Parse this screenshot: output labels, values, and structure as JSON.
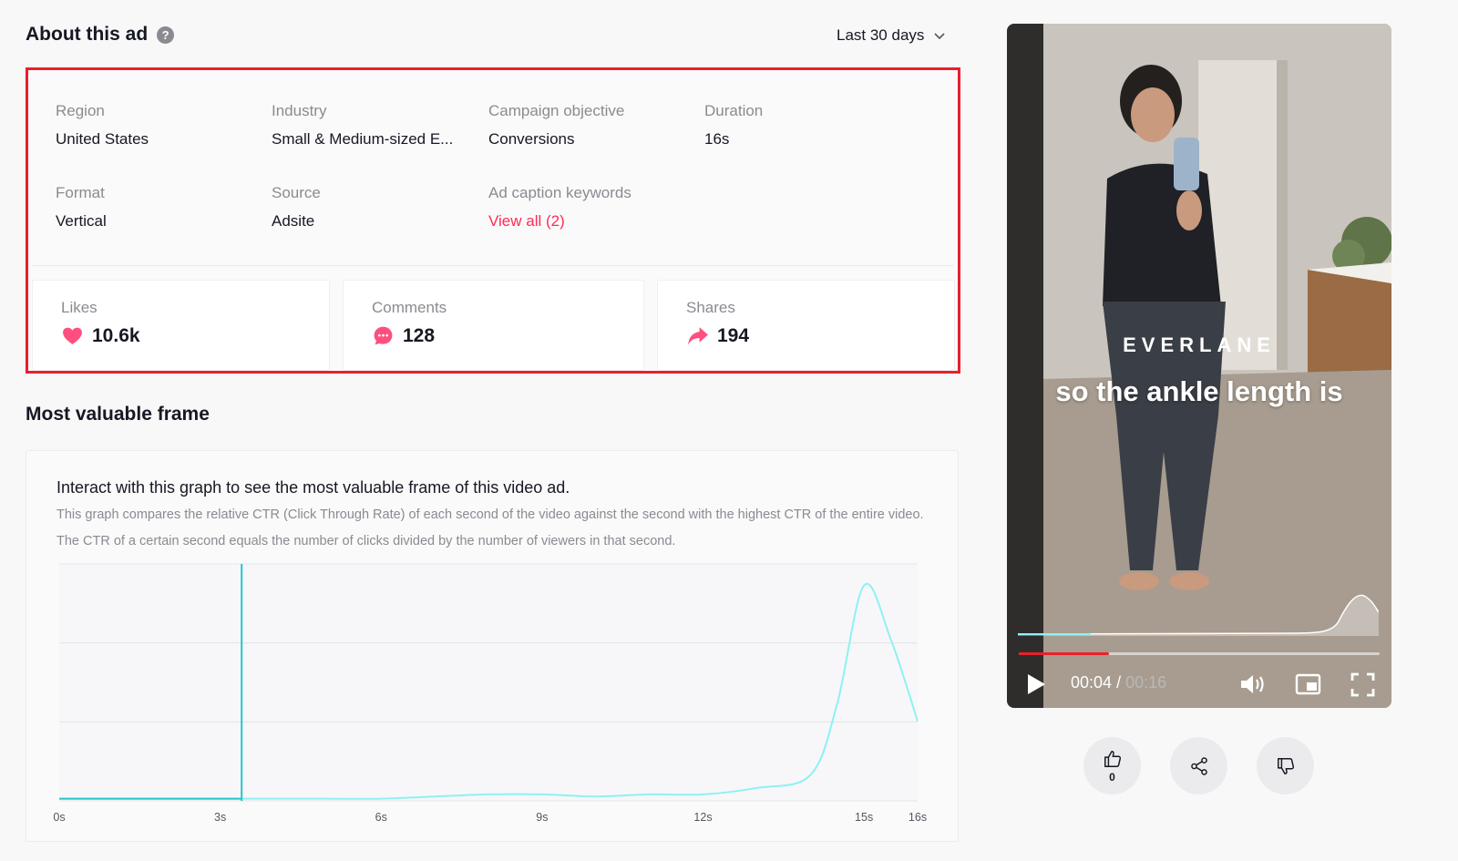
{
  "header": {
    "title": "About this ad",
    "date_range": "Last 30 days"
  },
  "details": {
    "region": {
      "label": "Region",
      "value": "United States"
    },
    "industry": {
      "label": "Industry",
      "value": "Small & Medium-sized E..."
    },
    "objective": {
      "label": "Campaign objective",
      "value": "Conversions"
    },
    "duration": {
      "label": "Duration",
      "value": "16s"
    },
    "format": {
      "label": "Format",
      "value": "Vertical"
    },
    "source": {
      "label": "Source",
      "value": "Adsite"
    },
    "keywords": {
      "label": "Ad caption keywords",
      "value": "View all (2)"
    }
  },
  "stats": {
    "likes": {
      "label": "Likes",
      "value": "10.6k"
    },
    "comments": {
      "label": "Comments",
      "value": "128"
    },
    "shares": {
      "label": "Shares",
      "value": "194"
    }
  },
  "frame": {
    "title": "Most valuable frame",
    "heading": "Interact with this graph to see the most valuable frame of this video ad.",
    "description": "This graph compares the relative CTR (Click Through Rate) of each second of the video against the second with the highest CTR of the entire video. The CTR of a certain second equals the number of clicks divided by the number of viewers in that second."
  },
  "chart_data": {
    "type": "line",
    "x": [
      0,
      1,
      2,
      3,
      4,
      5,
      6,
      7,
      8,
      9,
      10,
      11,
      12,
      13,
      14,
      14.5,
      15,
      15.5,
      16
    ],
    "values": [
      0.01,
      0.01,
      0.01,
      0.01,
      0.01,
      0.01,
      0.01,
      0.02,
      0.03,
      0.03,
      0.02,
      0.03,
      0.03,
      0.06,
      0.12,
      0.45,
      1.0,
      0.75,
      0.37
    ],
    "x_ticks": [
      "0s",
      "3s",
      "6s",
      "9s",
      "12s",
      "15s",
      "16s"
    ],
    "x_tick_values": [
      0,
      3,
      6,
      9,
      12,
      15,
      16
    ],
    "xlim": [
      0,
      16
    ],
    "ylim": [
      0,
      1.1
    ],
    "marker_x": 3.4,
    "grid": true,
    "line_color": "#8ef1f2",
    "marker_color": "#25c6cc"
  },
  "video": {
    "brand": "EVERLANE",
    "caption": "so the ankle length is",
    "current_time": "00:04",
    "separator": "/",
    "duration": "00:16",
    "progress": 0.25
  },
  "actions": {
    "like_count": "0"
  },
  "colors": {
    "accent": "#fe2c55",
    "highlight_border": "#e8202c",
    "text_muted": "#8a8b91"
  },
  "icons": [
    "help-icon",
    "chevron-down-icon",
    "heart-icon",
    "comment-icon",
    "share-arrow-icon",
    "play-icon",
    "volume-icon",
    "picture-in-picture-icon",
    "fullscreen-icon",
    "thumbs-up-icon",
    "share-icon",
    "thumbs-down-icon"
  ]
}
